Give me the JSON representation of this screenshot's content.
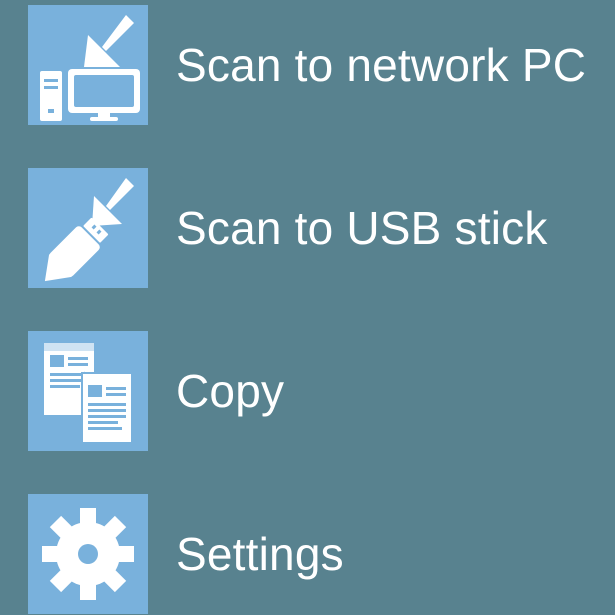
{
  "menu": {
    "items": [
      {
        "label": "Scan to network PC",
        "icon": "scan-to-pc-icon"
      },
      {
        "label": "Scan to USB stick",
        "icon": "scan-to-usb-icon"
      },
      {
        "label": "Copy",
        "icon": "copy-documents-icon"
      },
      {
        "label": "Settings",
        "icon": "gear-icon"
      }
    ]
  },
  "colors": {
    "background": "#58828f",
    "tile": "#79b1dc",
    "text": "#ffffff"
  }
}
